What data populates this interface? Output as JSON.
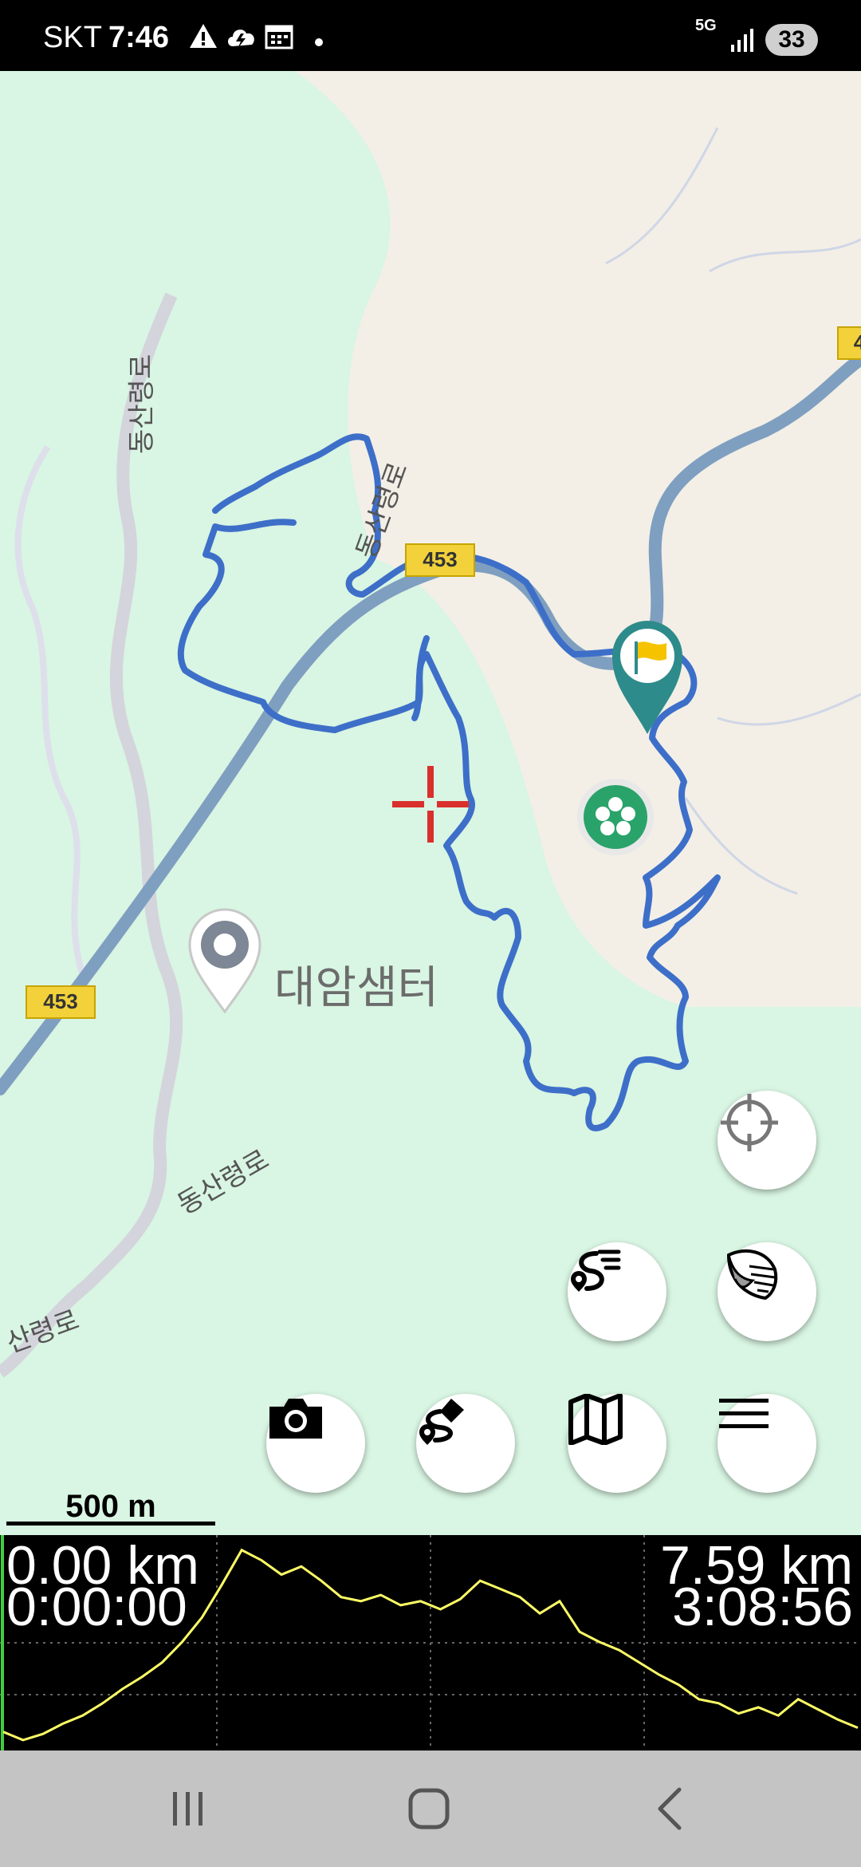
{
  "status_bar": {
    "carrier": "SKT",
    "time": "7:46",
    "network": "5G",
    "battery": "33"
  },
  "map": {
    "place_label": "대암샘터",
    "road_labels": [
      "동산령로",
      "동산령로",
      "동산령로",
      "산령로"
    ],
    "route_shields": [
      "453",
      "453",
      "4"
    ],
    "colors": {
      "track": "#3d6fc9",
      "highway": "#7f9fc0",
      "forest": "#d9f5e3",
      "land": "#f3efe6",
      "flag_marker": "#2e8b8b"
    }
  },
  "controls": {
    "locate_icon": "crosshair-icon",
    "layers_icon": "layers-icon",
    "routes_icon": "route-list-icon",
    "camera_icon": "camera-icon",
    "draw_route_icon": "draw-route-icon",
    "map_icon": "map-icon",
    "menu_icon": "menu-icon"
  },
  "scale": {
    "label": "500 m"
  },
  "elevation": {
    "start_distance": "0.00 km",
    "start_time": "0:00:00",
    "end_distance": "7.59 km",
    "end_time": "3:08:56",
    "line_color": "#ffff66",
    "profile": [
      0.06,
      0.02,
      0.05,
      0.1,
      0.14,
      0.2,
      0.27,
      0.33,
      0.4,
      0.5,
      0.62,
      0.78,
      0.95,
      0.9,
      0.83,
      0.87,
      0.8,
      0.72,
      0.7,
      0.73,
      0.68,
      0.7,
      0.66,
      0.71,
      0.8,
      0.76,
      0.72,
      0.64,
      0.7,
      0.55,
      0.5,
      0.46,
      0.4,
      0.34,
      0.29,
      0.22,
      0.2,
      0.15,
      0.18,
      0.14,
      0.22,
      0.17,
      0.12,
      0.08
    ]
  },
  "nav_bar": {
    "recents_icon": "recents-icon",
    "home_icon": "home-icon",
    "back_icon": "back-icon"
  }
}
